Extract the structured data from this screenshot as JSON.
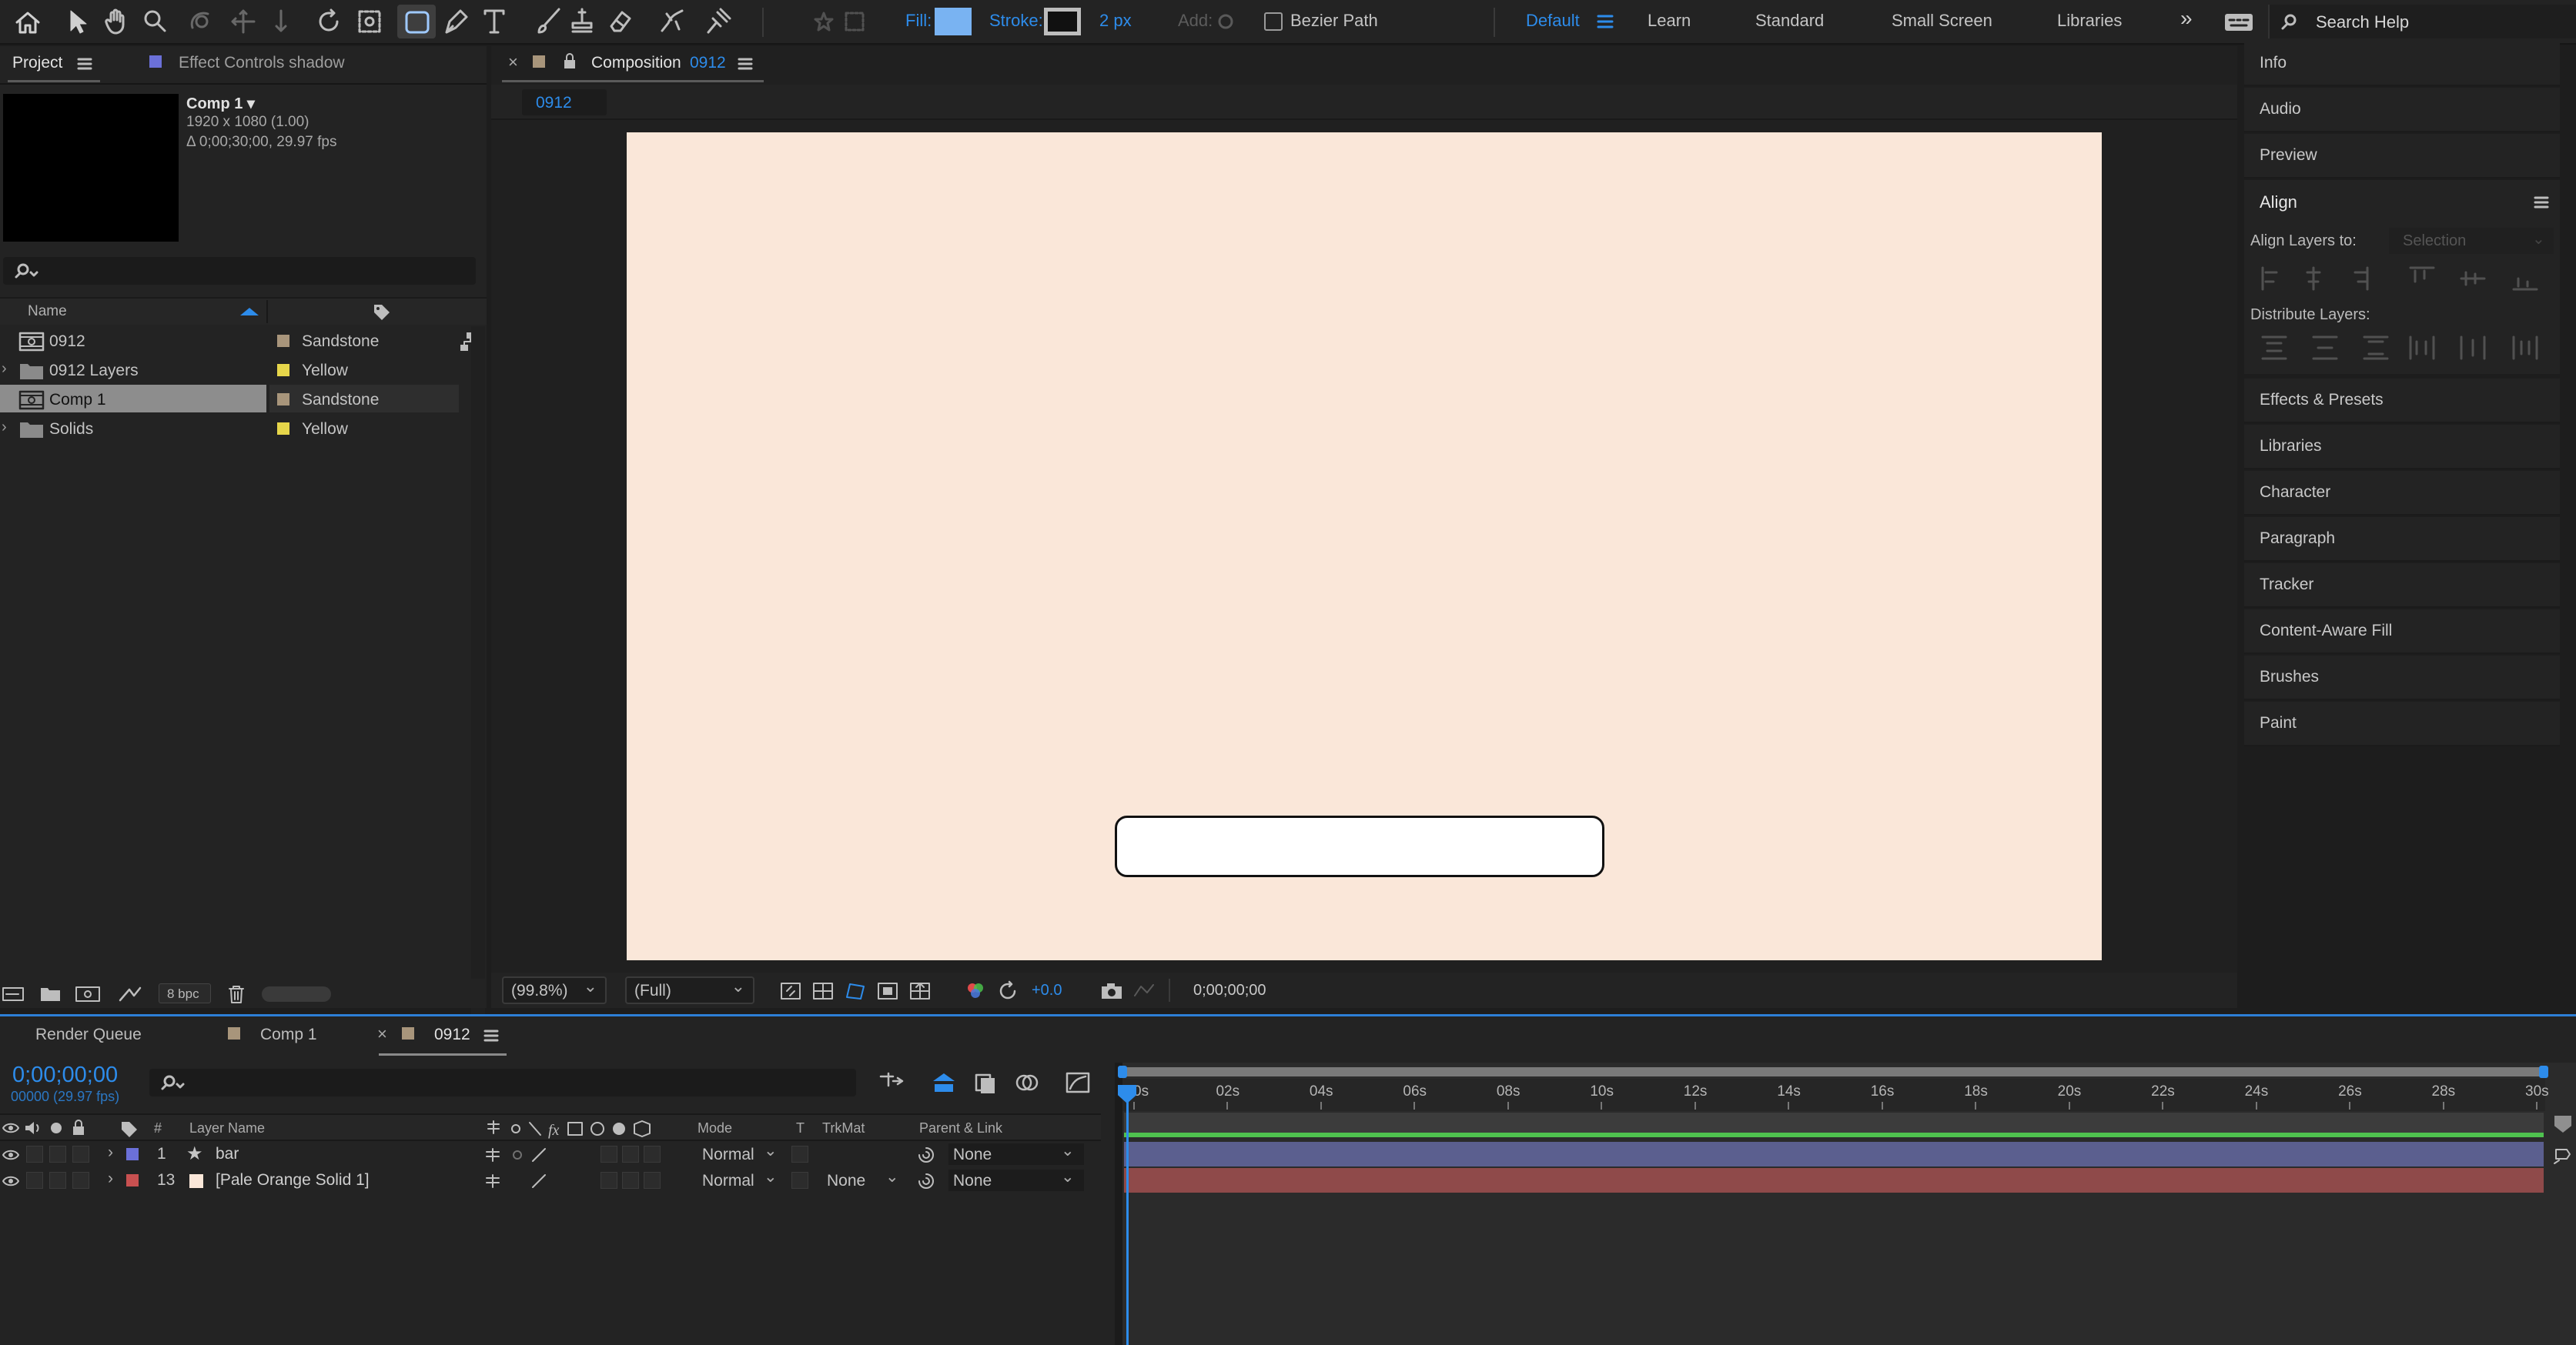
{
  "toolbar": {
    "fill_label": "Fill:",
    "stroke_label": "Stroke:",
    "stroke_width": "2 px",
    "add_label": "Add:",
    "bezier_label": "Bezier Path",
    "workspaces": [
      "Default",
      "Learn",
      "Standard",
      "Small Screen",
      "Libraries"
    ],
    "search_placeholder": "Search Help",
    "fill_color": "#79b3f2",
    "stroke_color": "#111111"
  },
  "project": {
    "tab_project": "Project",
    "tab_effect_controls": "Effect Controls shadow",
    "preview_name": "Comp 1 ▾",
    "preview_info_1": "1920 x 1080 (1.00)",
    "preview_info_2": "Δ 0;00;30;00, 29.97 fps",
    "col_name": "Name",
    "items": [
      {
        "name": "0912",
        "label": "Sandstone",
        "color": "#a8957b",
        "type": "comp"
      },
      {
        "name": "0912 Layers",
        "label": "Yellow",
        "color": "#e6d64a",
        "type": "folder"
      },
      {
        "name": "Comp 1",
        "label": "Sandstone",
        "color": "#a8957b",
        "type": "comp"
      },
      {
        "name": "Solids",
        "label": "Yellow",
        "color": "#e6d64a",
        "type": "folder"
      }
    ],
    "bpc": "8 bpc"
  },
  "composition": {
    "tab_prefix": "Composition",
    "tab_name": "0912",
    "breadcrumb": "0912",
    "canvas_color": "#fae7d9",
    "zoom": "(99.8%)",
    "resolution": "(Full)",
    "exposure": "+0.0",
    "timecode": "0;00;00;00"
  },
  "right_panel": {
    "items_top": [
      "Info",
      "Audio",
      "Preview"
    ],
    "align_title": "Align",
    "align_layers_to": "Align Layers to:",
    "align_selection": "Selection",
    "distribute_layers": "Distribute Layers:",
    "items_bottom": [
      "Effects & Presets",
      "Libraries",
      "Character",
      "Paragraph",
      "Tracker",
      "Content-Aware Fill",
      "Brushes",
      "Paint"
    ]
  },
  "timeline": {
    "tabs": [
      "Render Queue",
      "Comp 1",
      "0912"
    ],
    "timecode": "0;00;00;00",
    "frame_info": "00000 (29.97 fps)",
    "col_layer_name": "Layer Name",
    "col_mode": "Mode",
    "col_t": "T",
    "col_trkmat": "TrkMat",
    "col_parent": "Parent & Link",
    "col_hash": "#",
    "ticks": [
      "0s",
      "02s",
      "04s",
      "06s",
      "08s",
      "10s",
      "12s",
      "14s",
      "16s",
      "18s",
      "20s",
      "22s",
      "24s",
      "26s",
      "28s",
      "30s"
    ],
    "layers": [
      {
        "num": "1",
        "name": "bar",
        "color": "#6b70d8",
        "mode": "Normal",
        "trkmat": "",
        "parent": "None",
        "bar_color": "#5b5f8f"
      },
      {
        "num": "13",
        "name": "[Pale Orange Solid 1]",
        "color": "#c85050",
        "mode": "Normal",
        "trkmat": "None",
        "parent": "None",
        "bar_color": "#8f4a4a"
      }
    ]
  }
}
